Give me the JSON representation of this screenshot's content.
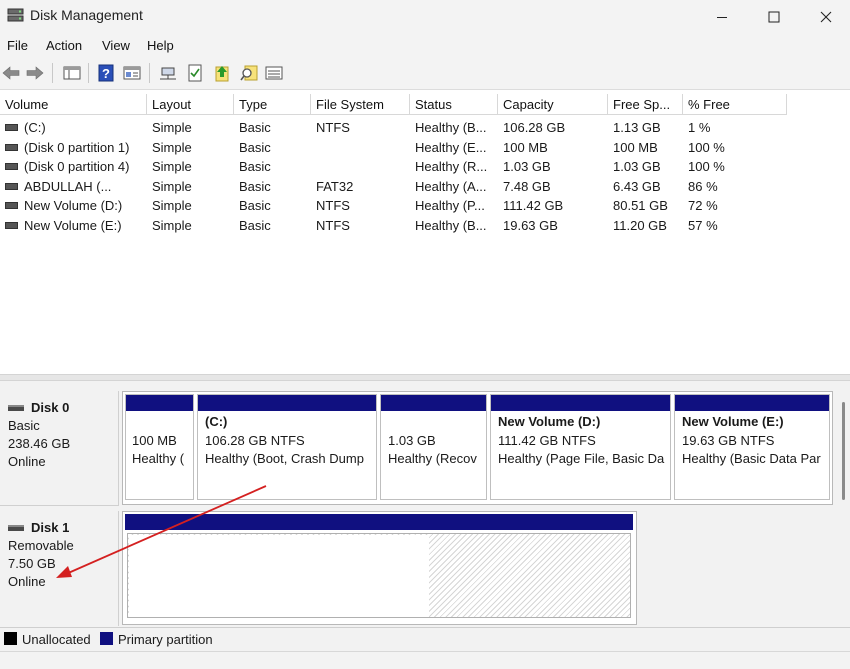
{
  "window": {
    "title": "Disk Management"
  },
  "menu": [
    "File",
    "Action",
    "View",
    "Help"
  ],
  "toolbar": [
    "back-icon",
    "forward-icon",
    "console-tree-icon",
    "help-icon",
    "properties-icon",
    "connect-icon",
    "checklist-icon",
    "up-arrow-icon",
    "search-icon",
    "list-view-icon"
  ],
  "columns": [
    "Volume",
    "Layout",
    "Type",
    "File System",
    "Status",
    "Capacity",
    "Free Sp...",
    "% Free"
  ],
  "volumes": [
    {
      "volume": "(C:)",
      "layout": "Simple",
      "type": "Basic",
      "fs": "NTFS",
      "status": "Healthy (B...",
      "capacity": "106.28 GB",
      "free": "1.13 GB",
      "pct": "1 %"
    },
    {
      "volume": "(Disk 0 partition 1)",
      "layout": "Simple",
      "type": "Basic",
      "fs": "",
      "status": "Healthy (E...",
      "capacity": "100 MB",
      "free": "100 MB",
      "pct": "100 %"
    },
    {
      "volume": "(Disk 0 partition 4)",
      "layout": "Simple",
      "type": "Basic",
      "fs": "",
      "status": "Healthy (R...",
      "capacity": "1.03 GB",
      "free": "1.03 GB",
      "pct": "100 %"
    },
    {
      "volume": "ABDULLAH (...",
      "layout": "Simple",
      "type": "Basic",
      "fs": "FAT32",
      "status": "Healthy (A...",
      "capacity": "7.48 GB",
      "free": "6.43 GB",
      "pct": "86 %"
    },
    {
      "volume": "New Volume (D:)",
      "layout": "Simple",
      "type": "Basic",
      "fs": "NTFS",
      "status": "Healthy (P...",
      "capacity": "111.42 GB",
      "free": "80.51 GB",
      "pct": "72 %"
    },
    {
      "volume": "New Volume (E:)",
      "layout": "Simple",
      "type": "Basic",
      "fs": "NTFS",
      "status": "Healthy (B...",
      "capacity": "19.63 GB",
      "free": "11.20 GB",
      "pct": "57 %"
    }
  ],
  "disks": [
    {
      "name": "Disk 0",
      "type": "Basic",
      "size": "238.46 GB",
      "state": "Online",
      "partitions": [
        {
          "title": "",
          "size": "100 MB",
          "status": "Healthy ("
        },
        {
          "title": "(C:)",
          "size": "106.28 GB NTFS",
          "status": "Healthy (Boot, Crash Dump"
        },
        {
          "title": "",
          "size": "1.03 GB",
          "status": "Healthy (Recov"
        },
        {
          "title": "New Volume  (D:)",
          "size": "111.42 GB NTFS",
          "status": "Healthy (Page File, Basic Da"
        },
        {
          "title": "New Volume  (E:)",
          "size": "19.63 GB NTFS",
          "status": "Healthy (Basic Data Par"
        }
      ]
    },
    {
      "name": "Disk 1",
      "type": "Removable",
      "size": "7.50 GB",
      "state": "Online"
    }
  ],
  "legend": [
    {
      "label": "Unallocated",
      "color": "#000000"
    },
    {
      "label": "Primary partition",
      "color": "#101080"
    }
  ],
  "colors": {
    "partition_bar": "#101080",
    "annotation_arrow": "#d42020"
  }
}
